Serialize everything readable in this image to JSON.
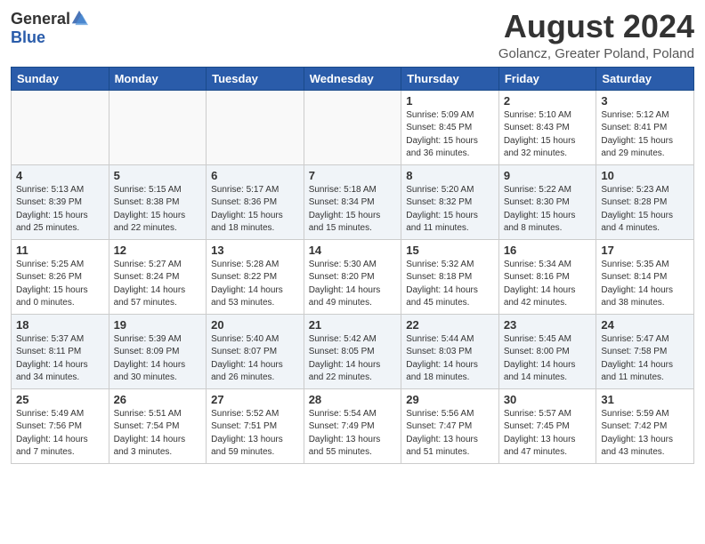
{
  "header": {
    "logo_general": "General",
    "logo_blue": "Blue",
    "month_year": "August 2024",
    "location": "Golancz, Greater Poland, Poland"
  },
  "weekdays": [
    "Sunday",
    "Monday",
    "Tuesday",
    "Wednesday",
    "Thursday",
    "Friday",
    "Saturday"
  ],
  "weeks": [
    [
      {
        "day": "",
        "info": ""
      },
      {
        "day": "",
        "info": ""
      },
      {
        "day": "",
        "info": ""
      },
      {
        "day": "",
        "info": ""
      },
      {
        "day": "1",
        "info": "Sunrise: 5:09 AM\nSunset: 8:45 PM\nDaylight: 15 hours\nand 36 minutes."
      },
      {
        "day": "2",
        "info": "Sunrise: 5:10 AM\nSunset: 8:43 PM\nDaylight: 15 hours\nand 32 minutes."
      },
      {
        "day": "3",
        "info": "Sunrise: 5:12 AM\nSunset: 8:41 PM\nDaylight: 15 hours\nand 29 minutes."
      }
    ],
    [
      {
        "day": "4",
        "info": "Sunrise: 5:13 AM\nSunset: 8:39 PM\nDaylight: 15 hours\nand 25 minutes."
      },
      {
        "day": "5",
        "info": "Sunrise: 5:15 AM\nSunset: 8:38 PM\nDaylight: 15 hours\nand 22 minutes."
      },
      {
        "day": "6",
        "info": "Sunrise: 5:17 AM\nSunset: 8:36 PM\nDaylight: 15 hours\nand 18 minutes."
      },
      {
        "day": "7",
        "info": "Sunrise: 5:18 AM\nSunset: 8:34 PM\nDaylight: 15 hours\nand 15 minutes."
      },
      {
        "day": "8",
        "info": "Sunrise: 5:20 AM\nSunset: 8:32 PM\nDaylight: 15 hours\nand 11 minutes."
      },
      {
        "day": "9",
        "info": "Sunrise: 5:22 AM\nSunset: 8:30 PM\nDaylight: 15 hours\nand 8 minutes."
      },
      {
        "day": "10",
        "info": "Sunrise: 5:23 AM\nSunset: 8:28 PM\nDaylight: 15 hours\nand 4 minutes."
      }
    ],
    [
      {
        "day": "11",
        "info": "Sunrise: 5:25 AM\nSunset: 8:26 PM\nDaylight: 15 hours\nand 0 minutes."
      },
      {
        "day": "12",
        "info": "Sunrise: 5:27 AM\nSunset: 8:24 PM\nDaylight: 14 hours\nand 57 minutes."
      },
      {
        "day": "13",
        "info": "Sunrise: 5:28 AM\nSunset: 8:22 PM\nDaylight: 14 hours\nand 53 minutes."
      },
      {
        "day": "14",
        "info": "Sunrise: 5:30 AM\nSunset: 8:20 PM\nDaylight: 14 hours\nand 49 minutes."
      },
      {
        "day": "15",
        "info": "Sunrise: 5:32 AM\nSunset: 8:18 PM\nDaylight: 14 hours\nand 45 minutes."
      },
      {
        "day": "16",
        "info": "Sunrise: 5:34 AM\nSunset: 8:16 PM\nDaylight: 14 hours\nand 42 minutes."
      },
      {
        "day": "17",
        "info": "Sunrise: 5:35 AM\nSunset: 8:14 PM\nDaylight: 14 hours\nand 38 minutes."
      }
    ],
    [
      {
        "day": "18",
        "info": "Sunrise: 5:37 AM\nSunset: 8:11 PM\nDaylight: 14 hours\nand 34 minutes."
      },
      {
        "day": "19",
        "info": "Sunrise: 5:39 AM\nSunset: 8:09 PM\nDaylight: 14 hours\nand 30 minutes."
      },
      {
        "day": "20",
        "info": "Sunrise: 5:40 AM\nSunset: 8:07 PM\nDaylight: 14 hours\nand 26 minutes."
      },
      {
        "day": "21",
        "info": "Sunrise: 5:42 AM\nSunset: 8:05 PM\nDaylight: 14 hours\nand 22 minutes."
      },
      {
        "day": "22",
        "info": "Sunrise: 5:44 AM\nSunset: 8:03 PM\nDaylight: 14 hours\nand 18 minutes."
      },
      {
        "day": "23",
        "info": "Sunrise: 5:45 AM\nSunset: 8:00 PM\nDaylight: 14 hours\nand 14 minutes."
      },
      {
        "day": "24",
        "info": "Sunrise: 5:47 AM\nSunset: 7:58 PM\nDaylight: 14 hours\nand 11 minutes."
      }
    ],
    [
      {
        "day": "25",
        "info": "Sunrise: 5:49 AM\nSunset: 7:56 PM\nDaylight: 14 hours\nand 7 minutes."
      },
      {
        "day": "26",
        "info": "Sunrise: 5:51 AM\nSunset: 7:54 PM\nDaylight: 14 hours\nand 3 minutes."
      },
      {
        "day": "27",
        "info": "Sunrise: 5:52 AM\nSunset: 7:51 PM\nDaylight: 13 hours\nand 59 minutes."
      },
      {
        "day": "28",
        "info": "Sunrise: 5:54 AM\nSunset: 7:49 PM\nDaylight: 13 hours\nand 55 minutes."
      },
      {
        "day": "29",
        "info": "Sunrise: 5:56 AM\nSunset: 7:47 PM\nDaylight: 13 hours\nand 51 minutes."
      },
      {
        "day": "30",
        "info": "Sunrise: 5:57 AM\nSunset: 7:45 PM\nDaylight: 13 hours\nand 47 minutes."
      },
      {
        "day": "31",
        "info": "Sunrise: 5:59 AM\nSunset: 7:42 PM\nDaylight: 13 hours\nand 43 minutes."
      }
    ]
  ]
}
